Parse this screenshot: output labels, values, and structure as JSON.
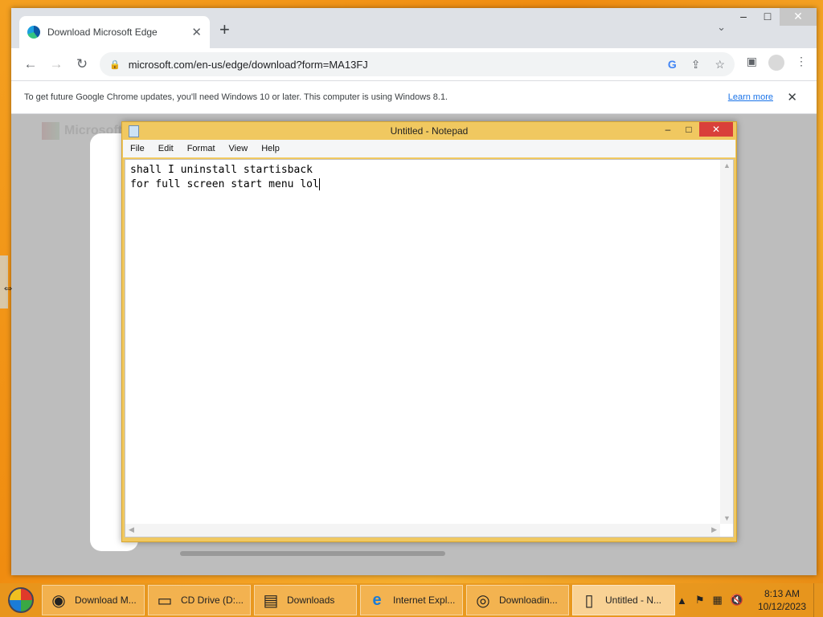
{
  "browser": {
    "tab_title": "Download Microsoft Edge",
    "url": "microsoft.com/en-us/edge/download?form=MA13FJ",
    "infobar_text": "To get future Google Chrome updates, you'll need Windows 10 or later. This computer is using Windows 8.1.",
    "infobar_link": "Learn more",
    "page_brand": "Microsoft"
  },
  "notepad": {
    "title": "Untitled - Notepad",
    "menu": [
      "File",
      "Edit",
      "Format",
      "View",
      "Help"
    ],
    "line1": "shall I uninstall startisback",
    "line2": "for full screen start menu lol"
  },
  "taskbar": {
    "items": [
      {
        "label": "Download M...",
        "icon": "chrome-icon"
      },
      {
        "label": "CD Drive (D:...",
        "icon": "cd-drive-icon"
      },
      {
        "label": "Downloads",
        "icon": "folder-icon"
      },
      {
        "label": "Internet Expl...",
        "icon": "ie-icon"
      },
      {
        "label": "Downloadin...",
        "icon": "installer-icon"
      },
      {
        "label": "Untitled - N...",
        "icon": "notepad-icon"
      }
    ],
    "time": "8:13 AM",
    "date": "10/12/2023"
  }
}
